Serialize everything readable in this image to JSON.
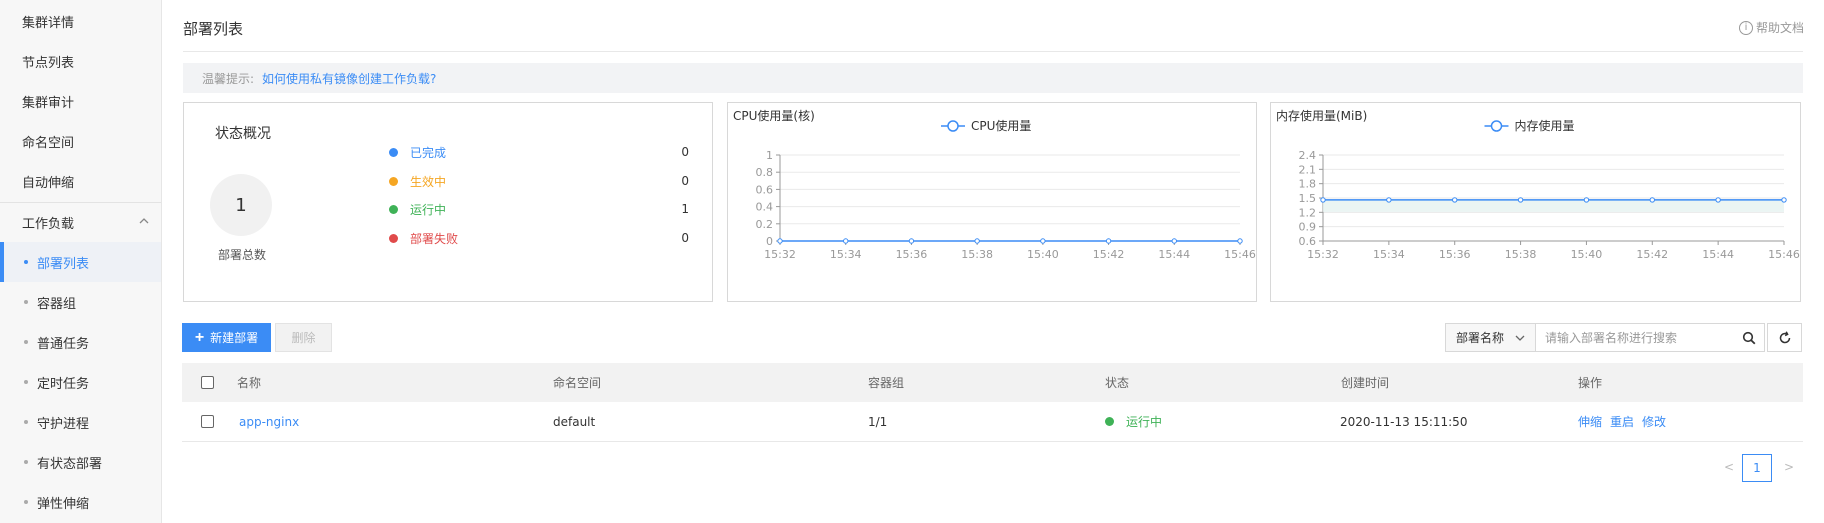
{
  "sidebar": {
    "items": [
      {
        "label": "集群详情"
      },
      {
        "label": "节点列表"
      },
      {
        "label": "集群审计"
      },
      {
        "label": "命名空间"
      },
      {
        "label": "自动伸缩"
      },
      {
        "label": "工作负载"
      }
    ],
    "sub_items": [
      {
        "label": "部署列表",
        "active": true
      },
      {
        "label": "容器组"
      },
      {
        "label": "普通任务"
      },
      {
        "label": "定时任务"
      },
      {
        "label": "守护进程"
      },
      {
        "label": "有状态部署"
      },
      {
        "label": "弹性伸缩"
      }
    ]
  },
  "header": {
    "title": "部署列表",
    "help_label": "帮助文档"
  },
  "tip": {
    "label": "温馨提示:",
    "link": "如何使用私有镜像创建工作负载?"
  },
  "status": {
    "title": "状态概况",
    "total": "1",
    "total_label": "部署总数",
    "rows": [
      {
        "label": "已完成",
        "count": "0",
        "color": "#3b8cf5"
      },
      {
        "label": "生效中",
        "count": "0",
        "color": "#f5a623"
      },
      {
        "label": "运行中",
        "count": "1",
        "color": "#3fb257"
      },
      {
        "label": "部署失败",
        "count": "0",
        "color": "#e04b4b"
      }
    ]
  },
  "chart_data": [
    {
      "type": "line",
      "title": "CPU使用量(核)",
      "x": [
        "15:32",
        "15:34",
        "15:36",
        "15:38",
        "15:40",
        "15:42",
        "15:44",
        "15:46"
      ],
      "series": [
        {
          "name": "CPU使用量",
          "values": [
            0,
            0,
            0,
            0,
            0,
            0,
            0,
            0
          ]
        }
      ],
      "yticks": [
        "0",
        "0.2",
        "0.4",
        "0.6",
        "0.8",
        "1"
      ],
      "ylim": [
        0,
        1
      ],
      "grid": true,
      "legend": "top-center",
      "color": "#3b8cf5"
    },
    {
      "type": "line",
      "title": "内存使用量(MiB)",
      "x": [
        "15:32",
        "15:34",
        "15:36",
        "15:38",
        "15:40",
        "15:42",
        "15:44",
        "15:46"
      ],
      "series": [
        {
          "name": "内存使用量",
          "values": [
            1.46,
            1.46,
            1.46,
            1.46,
            1.46,
            1.46,
            1.46,
            1.46
          ]
        }
      ],
      "yticks": [
        "0.6",
        "0.9",
        "1.2",
        "1.5",
        "1.8",
        "2.1",
        "2.4"
      ],
      "ylim": [
        0.6,
        2.4
      ],
      "grid": true,
      "legend": "top-center",
      "color": "#3b8cf5"
    }
  ],
  "toolbar": {
    "new_label": "新建部署",
    "delete_label": "删除",
    "search_field": "部署名称",
    "search_placeholder": "请输入部署名称进行搜索"
  },
  "table": {
    "columns": [
      "名称",
      "命名空间",
      "容器组",
      "状态",
      "创建时间",
      "操作"
    ],
    "rows": [
      {
        "name": "app-nginx",
        "namespace": "default",
        "pods": "1/1",
        "status": "运行中",
        "created": "2020-11-13 15:11:50",
        "ops": [
          "伸缩",
          "重启",
          "修改"
        ]
      }
    ]
  },
  "pagination": {
    "prev": "<",
    "page": "1",
    "next": ">"
  }
}
